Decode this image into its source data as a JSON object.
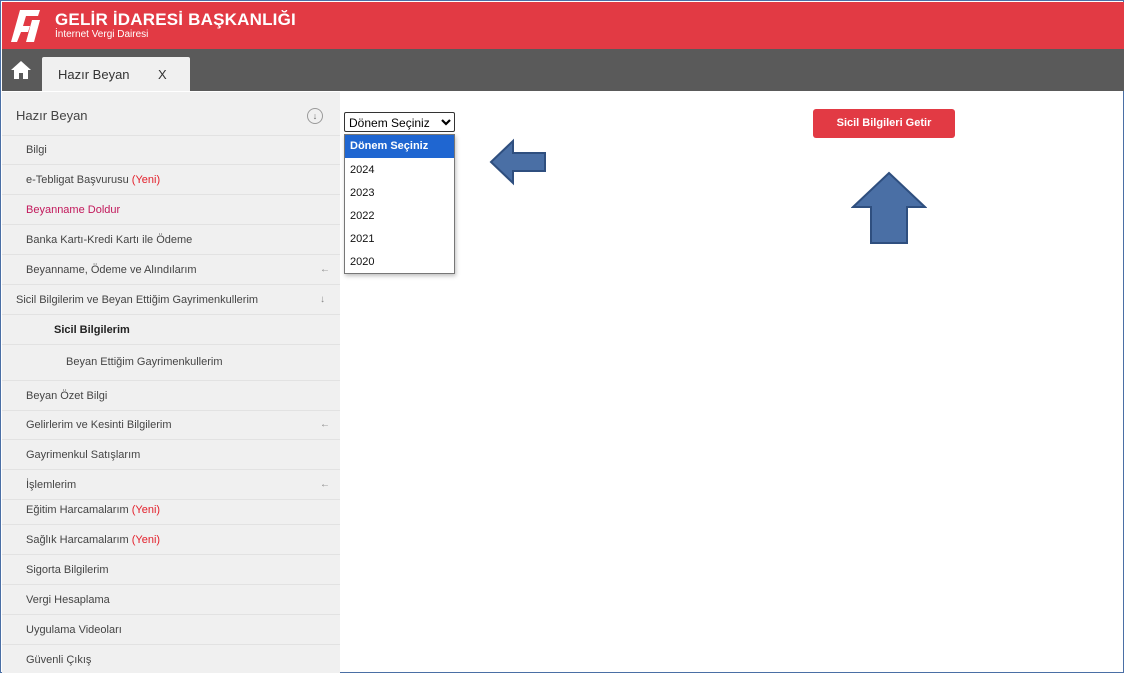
{
  "header": {
    "title": "GELİR İDARESİ BAŞKANLIĞI",
    "subtitle": "İnternet Vergi Dairesi",
    "logo_icon": "gib-logo-icon",
    "background": "#e23a44"
  },
  "tabbar": {
    "home_icon": "home-icon",
    "tab_label": "Hazır Beyan",
    "tab_close": "X"
  },
  "sidebar": {
    "header_label": "Hazır Beyan",
    "collapse_symbol": "↓",
    "items": [
      {
        "label": "Bilgi"
      },
      {
        "label": "e-Tebligat Başvurusu",
        "badge": "(Yeni)"
      },
      {
        "label": "Beyanname Doldur"
      },
      {
        "label": "Banka Kartı-Kredi Kartı ile Ödeme"
      },
      {
        "label": "Beyanname, Ödeme ve Alındılarım",
        "arrow": "←"
      },
      {
        "label": "Sicil Bilgilerim ve Beyan Ettiğim Gayrimenkullerim",
        "arrow": "↓"
      },
      {
        "label": "Sicil Bilgilerim"
      },
      {
        "label": "Beyan Ettiğim Gayrimenkullerim"
      },
      {
        "label": "Beyan Özet Bilgi"
      },
      {
        "label": "Gelirlerim ve Kesinti Bilgilerim",
        "arrow": "←"
      },
      {
        "label": "Gayrimenkul Satışlarım"
      },
      {
        "label": "İşlemlerim",
        "arrow": "←"
      },
      {
        "label": "Eğitim Harcamalarım",
        "badge": "(Yeni)"
      },
      {
        "label": "Sağlık Harcamalarım",
        "badge": "(Yeni)"
      },
      {
        "label": "Sigorta Bilgilerim"
      },
      {
        "label": "Vergi Hesaplama"
      },
      {
        "label": "Uygulama Videoları"
      },
      {
        "label": "Güvenli Çıkış"
      }
    ]
  },
  "period_select": {
    "value": "Dönem Seçiniz",
    "options": [
      "Dönem Seçiniz",
      "2024",
      "2023",
      "2022",
      "2021",
      "2020"
    ],
    "selected_option_color": "#1f66d1"
  },
  "action_button": {
    "label": "Sicil Bilgileri Getir",
    "color": "#e23a44"
  },
  "annotations": {
    "arrow_color": "#4a6fa5",
    "left_arrow_icon": "left-arrow-icon",
    "up_arrow_icon": "up-arrow-icon"
  }
}
